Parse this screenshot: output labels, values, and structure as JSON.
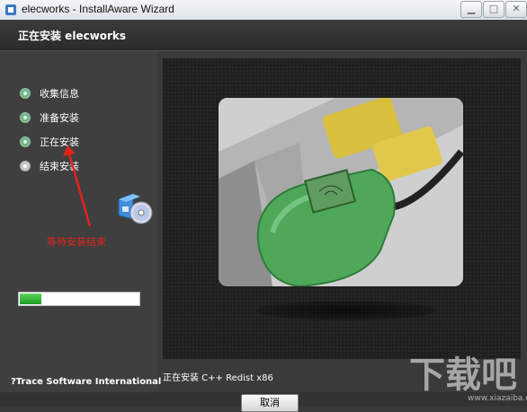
{
  "window": {
    "title": "elecworks - InstallAware Wizard",
    "min_icon": "minimize-icon",
    "max_icon": "maximize-icon",
    "close_icon": "close-icon"
  },
  "header": {
    "title": "正在安装 elecworks"
  },
  "steps": [
    {
      "label": "收集信息",
      "state": "done"
    },
    {
      "label": "准备安装",
      "state": "done"
    },
    {
      "label": "正在安装",
      "state": "current"
    },
    {
      "label": "结束安装",
      "state": "pending"
    }
  ],
  "annotation": {
    "text": "等待安装结束",
    "color": "#e0241b"
  },
  "progress": {
    "percent": 18
  },
  "company": "?Trace Software International",
  "status": "正在安装 C++ Redist x86",
  "buttons": {
    "cancel": "取消"
  },
  "watermark": {
    "text": "下载吧",
    "url": "www.xiazaiba.com"
  },
  "colors": {
    "accent": "#22a428",
    "background": "#3a3a3a"
  }
}
